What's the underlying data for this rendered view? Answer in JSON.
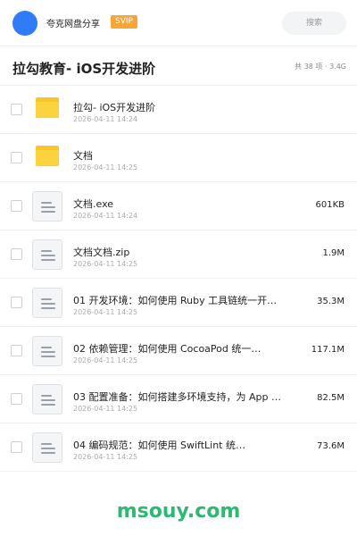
{
  "topbar": {
    "user_name": "夸克网盘分享",
    "badge": "SVIP",
    "search_placeholder": "搜索",
    "avatar_color": "#2f7cf6",
    "badge_color": "#f7a534"
  },
  "header": {
    "title": "拉勾教育- iOS开发进阶",
    "summary": "共 38 项 · 3.4G"
  },
  "files": [
    {
      "icon": "folder-icon",
      "name": "拉勾- iOS开发进阶",
      "date": "2026-04-11 14:24",
      "size": ""
    },
    {
      "icon": "folder-icon",
      "name": "文档",
      "date": "2026-04-11 14:25",
      "size": ""
    },
    {
      "icon": "document-icon",
      "name": "文档.exe",
      "date": "2026-04-11 14:24",
      "size": "601KB"
    },
    {
      "icon": "document-icon",
      "name": "文档文档.zip",
      "date": "2026-04-11 14:25",
      "size": "1.9M"
    },
    {
      "icon": "document-icon",
      "name": "01  开发环境：如何使用 Ruby 工具链统一开…",
      "date": "2026-04-11 14:25",
      "size": "35.3M"
    },
    {
      "icon": "document-icon",
      "name": "02  依赖管理：如何使用 CocoaPod 统一…",
      "date": "2026-04-11 14:25",
      "size": "117.1M"
    },
    {
      "icon": "document-icon",
      "name": "03  配置准备：如何搭建多环境支持，为 App …",
      "date": "2026-04-11 14:25",
      "size": "82.5M"
    },
    {
      "icon": "document-icon",
      "name": "04  编码规范：如何使用 SwiftLint 统…",
      "date": "2026-04-11 14:25",
      "size": "73.6M"
    }
  ],
  "watermark": {
    "text": "msouy.com",
    "color": "#2eb872"
  }
}
